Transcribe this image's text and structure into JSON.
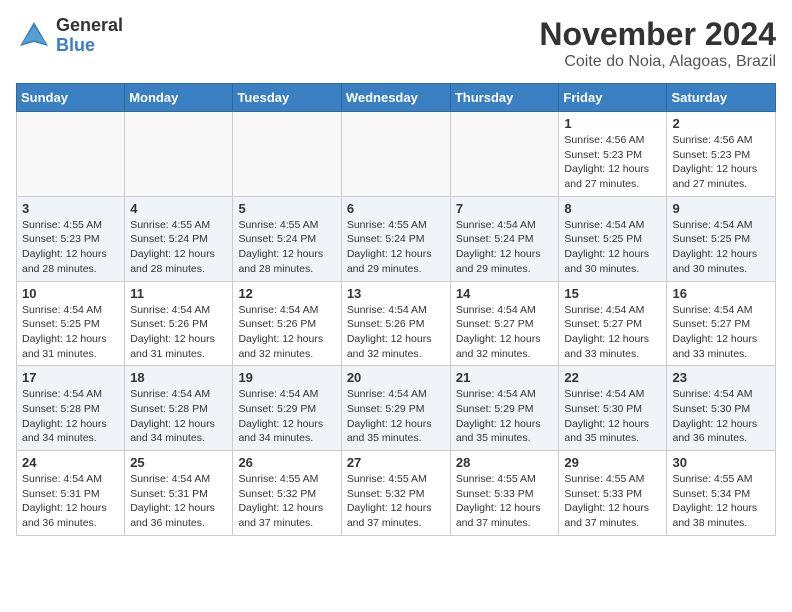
{
  "header": {
    "logo_general": "General",
    "logo_blue": "Blue",
    "month_title": "November 2024",
    "location": "Coite do Noia, Alagoas, Brazil"
  },
  "days_of_week": [
    "Sunday",
    "Monday",
    "Tuesday",
    "Wednesday",
    "Thursday",
    "Friday",
    "Saturday"
  ],
  "weeks": [
    [
      {
        "day": "",
        "info": ""
      },
      {
        "day": "",
        "info": ""
      },
      {
        "day": "",
        "info": ""
      },
      {
        "day": "",
        "info": ""
      },
      {
        "day": "",
        "info": ""
      },
      {
        "day": "1",
        "info": "Sunrise: 4:56 AM\nSunset: 5:23 PM\nDaylight: 12 hours\nand 27 minutes."
      },
      {
        "day": "2",
        "info": "Sunrise: 4:56 AM\nSunset: 5:23 PM\nDaylight: 12 hours\nand 27 minutes."
      }
    ],
    [
      {
        "day": "3",
        "info": "Sunrise: 4:55 AM\nSunset: 5:23 PM\nDaylight: 12 hours\nand 28 minutes."
      },
      {
        "day": "4",
        "info": "Sunrise: 4:55 AM\nSunset: 5:24 PM\nDaylight: 12 hours\nand 28 minutes."
      },
      {
        "day": "5",
        "info": "Sunrise: 4:55 AM\nSunset: 5:24 PM\nDaylight: 12 hours\nand 28 minutes."
      },
      {
        "day": "6",
        "info": "Sunrise: 4:55 AM\nSunset: 5:24 PM\nDaylight: 12 hours\nand 29 minutes."
      },
      {
        "day": "7",
        "info": "Sunrise: 4:54 AM\nSunset: 5:24 PM\nDaylight: 12 hours\nand 29 minutes."
      },
      {
        "day": "8",
        "info": "Sunrise: 4:54 AM\nSunset: 5:25 PM\nDaylight: 12 hours\nand 30 minutes."
      },
      {
        "day": "9",
        "info": "Sunrise: 4:54 AM\nSunset: 5:25 PM\nDaylight: 12 hours\nand 30 minutes."
      }
    ],
    [
      {
        "day": "10",
        "info": "Sunrise: 4:54 AM\nSunset: 5:25 PM\nDaylight: 12 hours\nand 31 minutes."
      },
      {
        "day": "11",
        "info": "Sunrise: 4:54 AM\nSunset: 5:26 PM\nDaylight: 12 hours\nand 31 minutes."
      },
      {
        "day": "12",
        "info": "Sunrise: 4:54 AM\nSunset: 5:26 PM\nDaylight: 12 hours\nand 32 minutes."
      },
      {
        "day": "13",
        "info": "Sunrise: 4:54 AM\nSunset: 5:26 PM\nDaylight: 12 hours\nand 32 minutes."
      },
      {
        "day": "14",
        "info": "Sunrise: 4:54 AM\nSunset: 5:27 PM\nDaylight: 12 hours\nand 32 minutes."
      },
      {
        "day": "15",
        "info": "Sunrise: 4:54 AM\nSunset: 5:27 PM\nDaylight: 12 hours\nand 33 minutes."
      },
      {
        "day": "16",
        "info": "Sunrise: 4:54 AM\nSunset: 5:27 PM\nDaylight: 12 hours\nand 33 minutes."
      }
    ],
    [
      {
        "day": "17",
        "info": "Sunrise: 4:54 AM\nSunset: 5:28 PM\nDaylight: 12 hours\nand 34 minutes."
      },
      {
        "day": "18",
        "info": "Sunrise: 4:54 AM\nSunset: 5:28 PM\nDaylight: 12 hours\nand 34 minutes."
      },
      {
        "day": "19",
        "info": "Sunrise: 4:54 AM\nSunset: 5:29 PM\nDaylight: 12 hours\nand 34 minutes."
      },
      {
        "day": "20",
        "info": "Sunrise: 4:54 AM\nSunset: 5:29 PM\nDaylight: 12 hours\nand 35 minutes."
      },
      {
        "day": "21",
        "info": "Sunrise: 4:54 AM\nSunset: 5:29 PM\nDaylight: 12 hours\nand 35 minutes."
      },
      {
        "day": "22",
        "info": "Sunrise: 4:54 AM\nSunset: 5:30 PM\nDaylight: 12 hours\nand 35 minutes."
      },
      {
        "day": "23",
        "info": "Sunrise: 4:54 AM\nSunset: 5:30 PM\nDaylight: 12 hours\nand 36 minutes."
      }
    ],
    [
      {
        "day": "24",
        "info": "Sunrise: 4:54 AM\nSunset: 5:31 PM\nDaylight: 12 hours\nand 36 minutes."
      },
      {
        "day": "25",
        "info": "Sunrise: 4:54 AM\nSunset: 5:31 PM\nDaylight: 12 hours\nand 36 minutes."
      },
      {
        "day": "26",
        "info": "Sunrise: 4:55 AM\nSunset: 5:32 PM\nDaylight: 12 hours\nand 37 minutes."
      },
      {
        "day": "27",
        "info": "Sunrise: 4:55 AM\nSunset: 5:32 PM\nDaylight: 12 hours\nand 37 minutes."
      },
      {
        "day": "28",
        "info": "Sunrise: 4:55 AM\nSunset: 5:33 PM\nDaylight: 12 hours\nand 37 minutes."
      },
      {
        "day": "29",
        "info": "Sunrise: 4:55 AM\nSunset: 5:33 PM\nDaylight: 12 hours\nand 37 minutes."
      },
      {
        "day": "30",
        "info": "Sunrise: 4:55 AM\nSunset: 5:34 PM\nDaylight: 12 hours\nand 38 minutes."
      }
    ]
  ]
}
